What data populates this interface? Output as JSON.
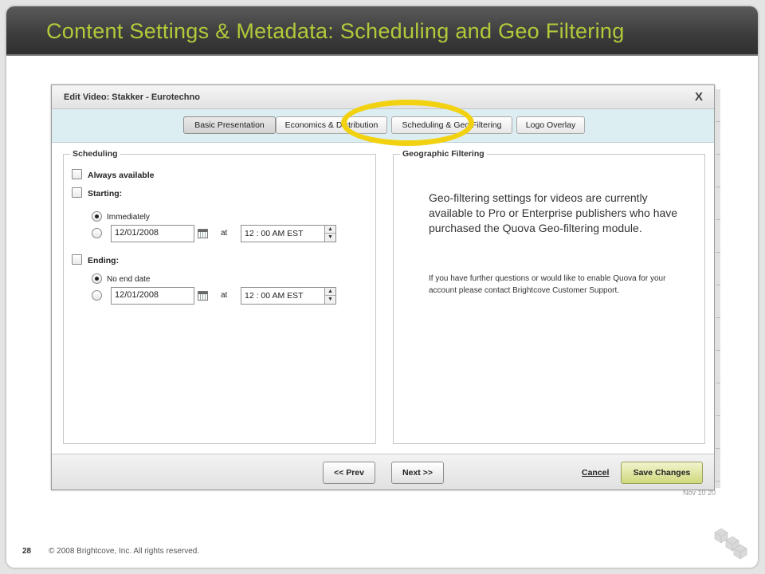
{
  "slide": {
    "title": "Content Settings & Metadata: Scheduling and Geo Filtering",
    "page_number": "28",
    "copyright": "© 2008 Brightcove, Inc. All rights reserved.",
    "logo_icon": "brightcove-cube-logo-icon",
    "behind_text": "Nov 10 20"
  },
  "dialog": {
    "title": "Edit Video: Stakker - Eurotechno",
    "close_glyph": "X",
    "tabs": [
      {
        "label": "Basic Presentation",
        "active": true
      },
      {
        "label": "Economics & Distribution",
        "active": false
      },
      {
        "label": "Scheduling & Geo Filtering",
        "active": false,
        "highlighted": true
      },
      {
        "label": "Logo Overlay",
        "active": false
      }
    ],
    "highlight_color": "#f2d210",
    "scheduling": {
      "legend": "Scheduling",
      "always_available_label": "Always available",
      "starting_label": "Starting:",
      "immediately_label": "Immediately",
      "start_date": "12/01/2008",
      "start_at_label": "at",
      "start_time": "12 : 00  AM  EST",
      "ending_label": "Ending:",
      "no_end_date_label": "No end date",
      "end_date": "12/01/2008",
      "end_at_label": "at",
      "end_time": "12 : 00  AM  EST"
    },
    "geo": {
      "legend": "Geographic Filtering",
      "main_text": "Geo-filtering settings for videos are currently available to Pro or Enterprise publishers who have purchased the Quova Geo-filtering module.",
      "sub_text": "If you have further questions or would like to enable Quova for your account please contact Brightcove Customer Support."
    },
    "footer": {
      "prev_label": "<< Prev",
      "next_label": "Next >>",
      "cancel_label": "Cancel",
      "save_label": "Save Changes"
    }
  },
  "colors": {
    "title_accent": "#b3c93a",
    "tabbar_bg": "#ddeef2",
    "save_button": "#d0d87e"
  }
}
